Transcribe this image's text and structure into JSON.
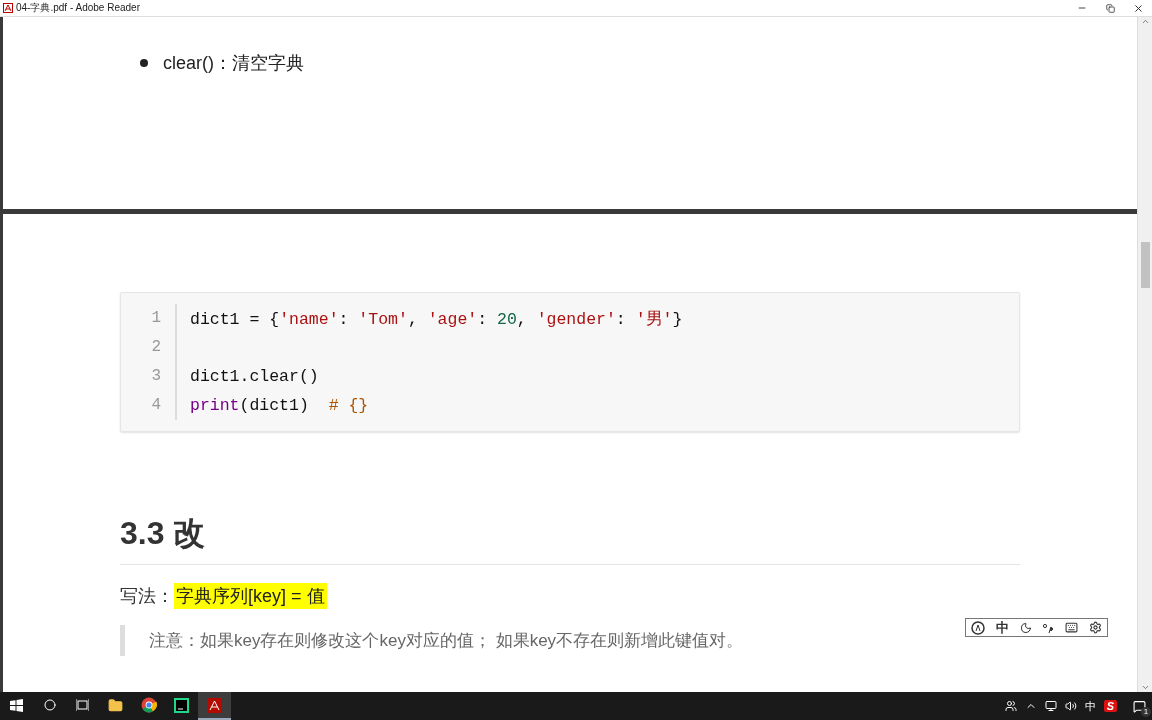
{
  "window": {
    "title": "04-字典.pdf - Adobe Reader"
  },
  "page_1": {
    "bullets": [
      "clear()：清空字典"
    ]
  },
  "page_2": {
    "code_lines": [
      {
        "number": "1",
        "tokens": [
          {
            "kind": "plain",
            "text": "dict1 = {"
          },
          {
            "kind": "string",
            "text": "'name'"
          },
          {
            "kind": "plain",
            "text": ": "
          },
          {
            "kind": "string",
            "text": "'Tom'"
          },
          {
            "kind": "plain",
            "text": ", "
          },
          {
            "kind": "string",
            "text": "'age'"
          },
          {
            "kind": "plain",
            "text": ": "
          },
          {
            "kind": "number",
            "text": "20"
          },
          {
            "kind": "plain",
            "text": ", "
          },
          {
            "kind": "string",
            "text": "'gender'"
          },
          {
            "kind": "plain",
            "text": ": "
          },
          {
            "kind": "string",
            "text": "'男'"
          },
          {
            "kind": "plain",
            "text": "}"
          }
        ]
      },
      {
        "number": "2"
      },
      {
        "number": "3",
        "tokens": [
          {
            "kind": "plain",
            "text": "dict1.clear()"
          }
        ]
      },
      {
        "number": "4",
        "tokens": [
          {
            "kind": "keyword",
            "text": "print"
          },
          {
            "kind": "plain",
            "text": "(dict1)  "
          },
          {
            "kind": "comment",
            "text": "# {}"
          }
        ]
      }
    ],
    "heading": "3.3 改",
    "syntax_label": "写法：",
    "syntax_highlight": "字典序列[key] = 值",
    "note": "注意：如果key存在则修改这个key对应的值； 如果key不存在则新增此键值对。"
  },
  "ime_toolbar": {
    "mode": "中"
  },
  "tray": {
    "language": "中",
    "ime_logo": "S",
    "notification_count": "1"
  }
}
